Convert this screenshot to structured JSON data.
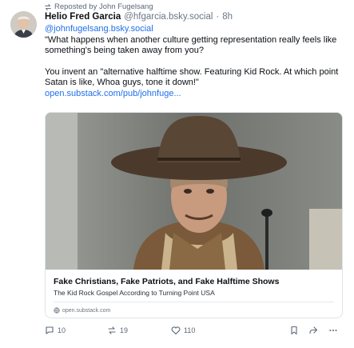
{
  "repost": {
    "label": "Reposted by John Fugelsang"
  },
  "post": {
    "author_name": "Helio Fred Garcia",
    "handle": "@hfgarcia.bsky.social",
    "separator": "·",
    "time": "8h",
    "mention": "@johnfugelsang.bsky.social",
    "quote": "\"What happens when another culture getting representation really feels like something's being taken away from you?",
    "body": "You invent an \"alternative halftime show. Featuring Kid Rock. At which point Satan is like, Whoa guys, tone it down!\"",
    "link": "open.substack.com/pub/johnfuge..."
  },
  "embed": {
    "title": "Fake Christians, Fake Patriots, and Fake Halftime Shows",
    "description": "The Kid Rock Gospel According to Turning Point USA",
    "domain": "open.substack.com"
  },
  "actions": {
    "reply_count": "10",
    "repost_count": "19",
    "like_count": "110"
  },
  "colors": {
    "link": "#1f6feb",
    "muted": "#6b7785",
    "border": "#dfe3e8"
  },
  "icons": [
    "repost-icon",
    "reply-icon",
    "like-icon",
    "bookmark-icon",
    "share-icon",
    "more-icon",
    "globe-icon"
  ]
}
